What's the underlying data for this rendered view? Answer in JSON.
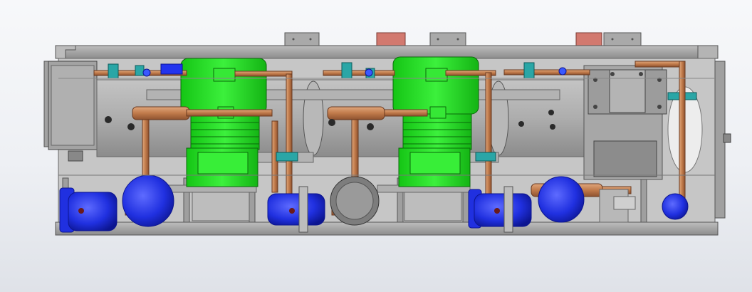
{
  "viewport": {
    "background_top": "#f7f8fa",
    "background_bottom": "#dfe2e8"
  },
  "model": {
    "palette": {
      "frame_gray": "#9a9a9a",
      "frame_dark": "#5e5e5e",
      "compressor_green": "#22dd22",
      "receiver_blue": "#2233ee",
      "pipe_copper": "#c98a5a",
      "valve_teal": "#2aa6a6",
      "cover_red": "#d27a70",
      "cover_gray": "#a8a8a8"
    },
    "parts": {
      "compressors": [
        "compressor-1",
        "compressor-2"
      ],
      "receivers": [
        "receiver-1",
        "receiver-2",
        "receiver-3",
        "receiver-4",
        "receiver-5",
        "receiver-6"
      ],
      "top_covers": [
        "gray",
        "red",
        "gray",
        "red",
        "gray"
      ]
    }
  }
}
